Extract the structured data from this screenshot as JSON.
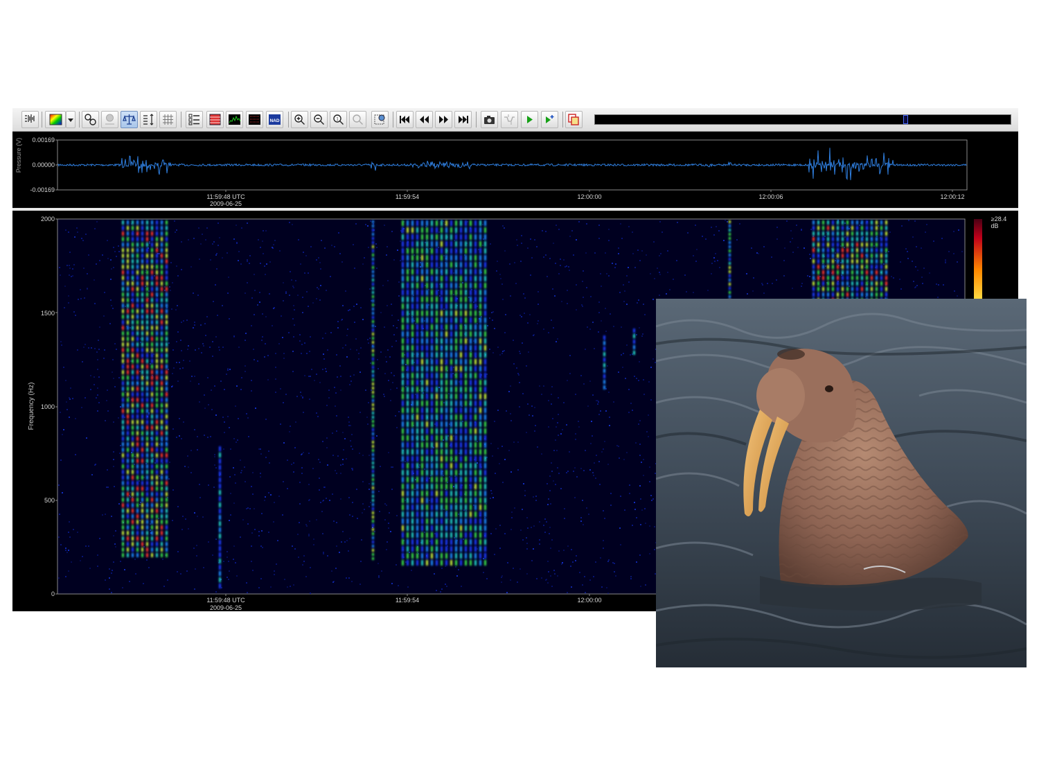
{
  "toolbar": {
    "buttons": [
      {
        "name": "waveform-view-icon",
        "active": false
      },
      {
        "name": "colormap-icon",
        "active": false
      },
      {
        "name": "colormap-dropdown-icon",
        "active": false
      },
      {
        "name": "link-icon",
        "active": false
      },
      {
        "name": "marker-icon",
        "active": false
      },
      {
        "name": "balance-scale-icon",
        "active": true
      },
      {
        "name": "amplitude-scale-icon",
        "active": false
      },
      {
        "name": "grid-icon",
        "active": false
      },
      {
        "name": "checklist-icon",
        "active": false
      },
      {
        "name": "layout-icon",
        "active": false
      },
      {
        "name": "spectrum-icon",
        "active": false
      },
      {
        "name": "spectrogram-icon",
        "active": false
      },
      {
        "name": "nad-icon",
        "active": false
      },
      {
        "name": "zoom-in-icon",
        "active": false
      },
      {
        "name": "zoom-out-icon",
        "active": false
      },
      {
        "name": "zoom-fit-icon",
        "active": false
      },
      {
        "name": "zoom-selection-icon",
        "active": false
      },
      {
        "name": "settings-icon",
        "active": false
      },
      {
        "name": "skip-start-icon",
        "active": false
      },
      {
        "name": "rewind-icon",
        "active": false
      },
      {
        "name": "fast-forward-icon",
        "active": false
      },
      {
        "name": "skip-end-icon",
        "active": false
      },
      {
        "name": "camera-icon",
        "active": false
      },
      {
        "name": "filter-icon",
        "active": false
      },
      {
        "name": "play-icon",
        "active": false
      },
      {
        "name": "play-selection-icon",
        "active": false
      },
      {
        "name": "export-icon",
        "active": false
      }
    ],
    "nad_label": "NAD",
    "scrub_position": 0.75
  },
  "waveform": {
    "ylabel": "Pressure (V)",
    "y_ticks": [
      "0.00169",
      "0.00000",
      "-0.00169"
    ],
    "x_ticks": [
      "11:59:48 UTC",
      "11:59:54",
      "12:00:00",
      "12:00:06",
      "12:00:12"
    ],
    "x_date": "2009-06-25",
    "line_color": "#2f7fe0"
  },
  "spectrogram": {
    "ylabel": "Frequency (Hz)",
    "y_ticks": [
      "2000",
      "1500",
      "1000",
      "500",
      "0"
    ],
    "x_ticks": [
      "11:59:48 UTC",
      "11:59:54",
      "12:00:00"
    ],
    "x_date": "2009-06-25",
    "colorbar_max": "≥28.4",
    "colorbar_unit": "dB"
  },
  "photo": {
    "subject": "walrus"
  }
}
